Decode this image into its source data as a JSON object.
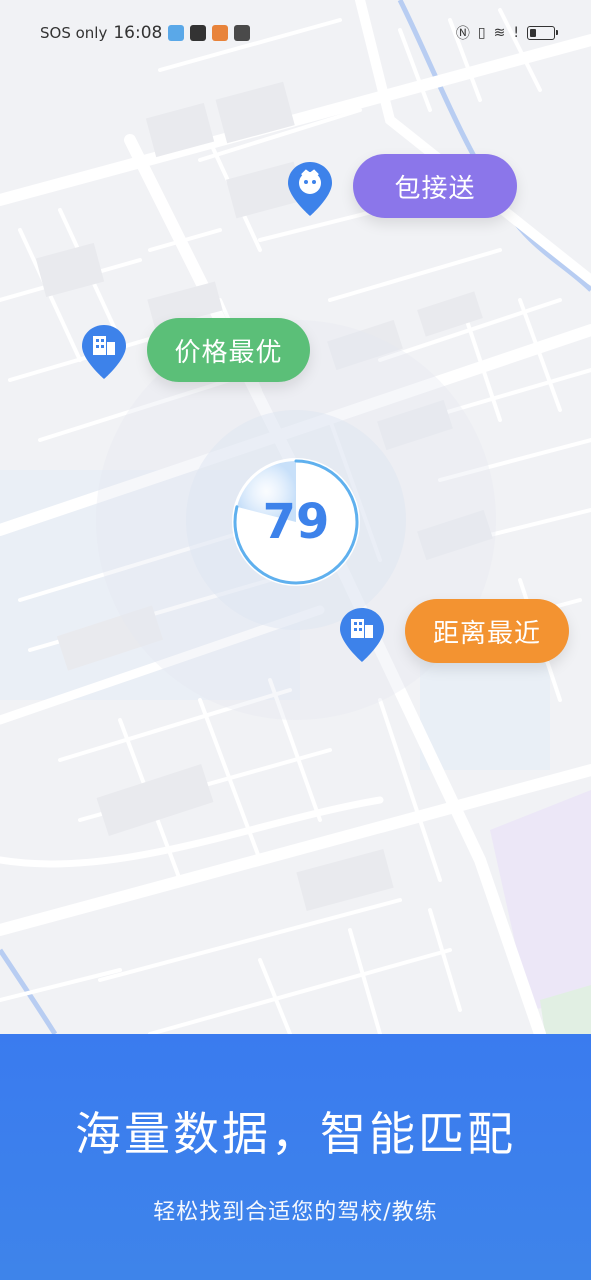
{
  "status_bar": {
    "carrier": "SOS only",
    "time": "16:08"
  },
  "map_tags": {
    "pickup": "包接送",
    "best_price": "价格最优",
    "nearest": "距离最近"
  },
  "score": {
    "value": "79",
    "progress_fraction": 0.79
  },
  "panel": {
    "title": "海量数据，智能匹配",
    "subtitle": "轻松找到合适您的驾校/教练"
  },
  "colors": {
    "accent_blue": "#3a7bef",
    "pin_blue": "#3d82ea",
    "tag_purple": "#8b76ea",
    "tag_green": "#5bbf78",
    "tag_orange": "#f39331"
  },
  "icons": {
    "pickup_pin": "avatar-pin-icon",
    "school_pin": "building-pin-icon"
  }
}
